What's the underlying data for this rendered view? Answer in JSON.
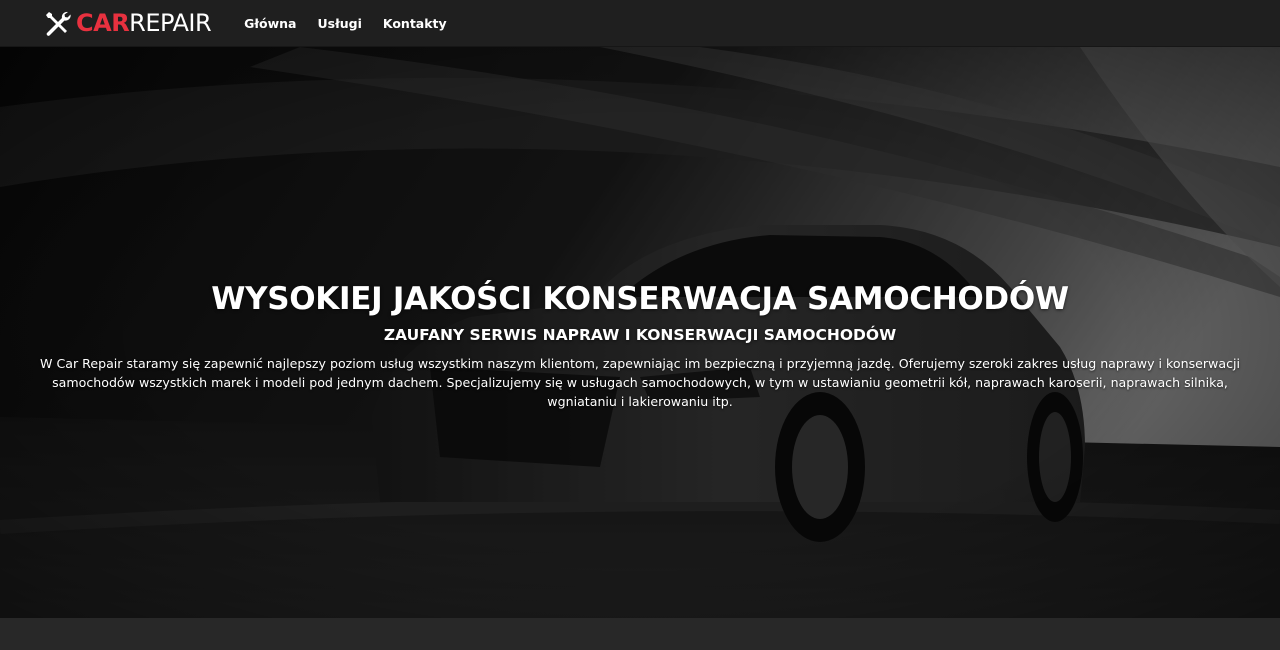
{
  "brand": {
    "name_part1": "CAR",
    "name_part2": "REPAIR",
    "icon": "wrench-screwdriver-icon",
    "accent_color": "#e8313f"
  },
  "nav": {
    "items": [
      {
        "label": "Główna"
      },
      {
        "label": "Usługi"
      },
      {
        "label": "Kontakty"
      }
    ]
  },
  "hero": {
    "title": "WYSOKIEJ JAKOŚCI KONSERWACJA SAMOCHODÓW",
    "subtitle": "ZAUFANY SERWIS NAPRAW I KONSERWACJI SAMOCHODÓW",
    "text": "W Car Repair staramy się zapewnić najlepszy poziom usług wszystkim naszym klientom, zapewniając im bezpieczną i przyjemną jazdę. Oferujemy szeroki zakres usług naprawy i konserwacji samochodów wszystkich marek i modeli pod jednym dachem. Specjalizujemy się w usługach samochodowych, w tym w ustawianiu geometrii kół, naprawach karoserii, naprawach silnika, wgniataniu i lakierowaniu itp.",
    "background": "dark-car-on-road-image"
  }
}
